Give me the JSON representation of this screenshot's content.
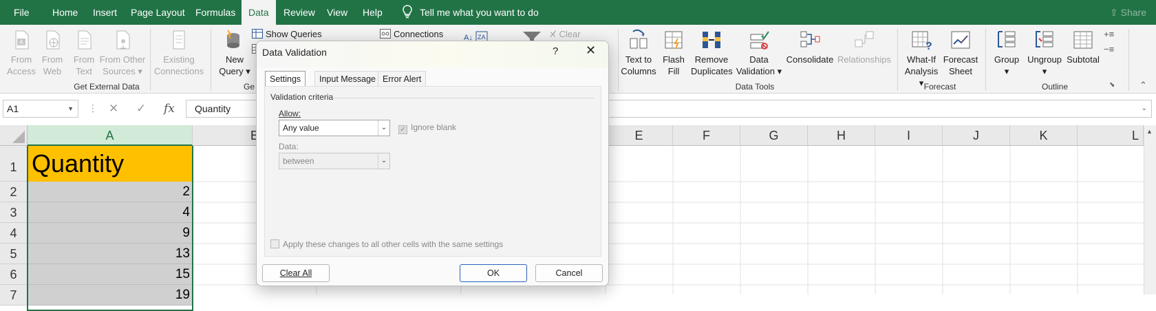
{
  "tabs": [
    "File",
    "Home",
    "Insert",
    "Page Layout",
    "Formulas",
    "Data",
    "Review",
    "View",
    "Help"
  ],
  "active_tab": "Data",
  "tell_me": "Tell me what you want to do",
  "share": "Share",
  "ribbon": {
    "from_access": [
      "From",
      "Access"
    ],
    "from_web": [
      "From",
      "Web"
    ],
    "from_text": [
      "From",
      "Text"
    ],
    "from_other": [
      "From Other",
      "Sources"
    ],
    "existing": [
      "Existing",
      "Connections"
    ],
    "get_external_data": "Get External Data",
    "new_query": [
      "New",
      "Query"
    ],
    "show_queries": "Show Queries",
    "get_short": "Ge",
    "connections": "Connections",
    "clear": "Clear",
    "text_to_columns": [
      "Text to",
      "Columns"
    ],
    "flash_fill": [
      "Flash",
      "Fill"
    ],
    "remove_duplicates": [
      "Remove",
      "Duplicates"
    ],
    "data_validation": [
      "Data",
      "Validation"
    ],
    "consolidate": "Consolidate",
    "relationships": "Relationships",
    "data_tools": "Data Tools",
    "what_if": [
      "What-If",
      "Analysis"
    ],
    "forecast_sheet": [
      "Forecast",
      "Sheet"
    ],
    "forecast": "Forecast",
    "group": "Group",
    "ungroup": "Ungroup",
    "subtotal": "Subtotal",
    "outline": "Outline"
  },
  "formula_bar": {
    "name_box": "A1",
    "formula": "Quantity"
  },
  "grid": {
    "columns": [
      "A",
      "E",
      "F",
      "G",
      "H",
      "I",
      "J",
      "K",
      "L"
    ],
    "partial_col": "E",
    "rows": [
      "1",
      "2",
      "3",
      "4",
      "5",
      "6",
      "7"
    ],
    "a1": "Quantity",
    "a_values": [
      "2",
      "4",
      "9",
      "13",
      "15",
      "19"
    ]
  },
  "dialog": {
    "title": "Data Validation",
    "help": "?",
    "tabs": [
      "Settings",
      "Input Message",
      "Error Alert"
    ],
    "criteria_label": "Validation criteria",
    "allow_label": "Allow:",
    "allow_value": "Any value",
    "ignore_blank": "Ignore blank",
    "data_label": "Data:",
    "data_value": "between",
    "apply_all": "Apply these changes to all other cells with the same settings",
    "clear_all": "Clear All",
    "ok": "OK",
    "cancel": "Cancel"
  }
}
